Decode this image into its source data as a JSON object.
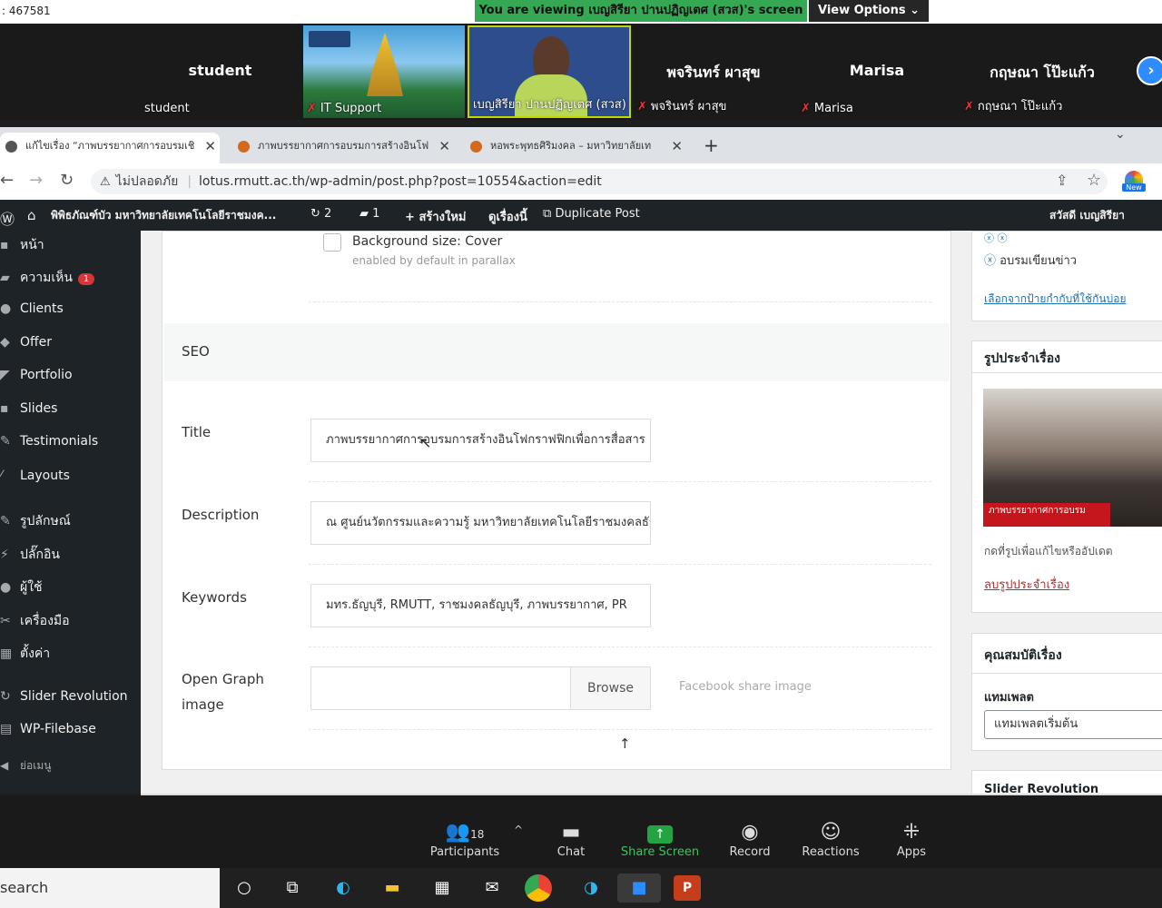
{
  "zoom": {
    "meeting_id": ": 467581",
    "viewing_banner": "You are viewing เบญสิรียา ปานปฏิญเตศ (สวส)'s screen",
    "view_options": "View Options ⌄",
    "participants": [
      {
        "big": "student",
        "small": "student",
        "muted": false
      },
      {
        "big": "",
        "small": "IT Support",
        "muted": true
      },
      {
        "big": "",
        "small": "เบญสิรียา ปานปฏิญเตศ (สวส)",
        "muted": false
      },
      {
        "big": "พจรินทร์ ผาสุข",
        "small": "พจรินทร์ ผาสุข",
        "muted": true
      },
      {
        "big": "Marisa",
        "small": "Marisa",
        "muted": true
      },
      {
        "big": "กฤษณา โป๊ะแก้ว",
        "small": "กฤษณา โป๊ะแก้ว",
        "muted": true
      }
    ],
    "toolbar": {
      "participants_label": "Participants",
      "participants_count": "18",
      "chat": "Chat",
      "share_screen": "Share Screen",
      "record": "Record",
      "reactions": "Reactions",
      "apps": "Apps"
    }
  },
  "browser": {
    "tabs": [
      {
        "title": "แก้ไขเรื่อง “ภาพบรรยากาศการอบรมเชิ"
      },
      {
        "title": "ภาพบรรยากาศการอบรมการสร้างอินโฟ"
      },
      {
        "title": "หอพระพุทธศิริมงคล – มหาวิทยาลัยเท"
      }
    ],
    "security_label": "ไม่ปลอดภัย",
    "url": "lotus.rmutt.ac.th/wp-admin/post.php?post=10554&action=edit",
    "new_badge": "New"
  },
  "wp_adminbar": {
    "site_name": "พิพิธภัณฑ์บัว มหาวิทยาลัยเทคโนโลยีราชมงค...",
    "updates": "2",
    "comments": "1",
    "new_label": "สร้างใหม่",
    "view_post": "ดูเรื่องนี้",
    "duplicate": "Duplicate Post",
    "greeting": "สวัสดี เบญสิรียา"
  },
  "wp_sidebar": {
    "items": [
      {
        "label": "หน้า",
        "icon": "page-icon"
      },
      {
        "label": "ความเห็น",
        "icon": "comment-icon",
        "badge": "1"
      },
      {
        "label": "Clients",
        "icon": "clients-icon"
      },
      {
        "label": "Offer",
        "icon": "offer-icon"
      },
      {
        "label": "Portfolio",
        "icon": "portfolio-icon"
      },
      {
        "label": "Slides",
        "icon": "slides-icon"
      },
      {
        "label": "Testimonials",
        "icon": "testimonials-icon"
      },
      {
        "label": "Layouts",
        "icon": "layouts-icon"
      },
      {
        "label": "รูปลักษณ์",
        "icon": "appearance-icon"
      },
      {
        "label": "ปลั๊กอิน",
        "icon": "plugin-icon"
      },
      {
        "label": "ผู้ใช้",
        "icon": "user-icon"
      },
      {
        "label": "เครื่องมือ",
        "icon": "tools-icon"
      },
      {
        "label": "ตั้งค่า",
        "icon": "settings-icon"
      },
      {
        "label": "Slider Revolution",
        "icon": "slider-icon"
      },
      {
        "label": "WP-Filebase",
        "icon": "filebase-icon"
      },
      {
        "label": "ย่อเมนู",
        "icon": "collapse-icon"
      }
    ]
  },
  "editor": {
    "bg_size_label": "Background size: Cover",
    "bg_size_hint": "enabled by default in parallax",
    "seo_heading": "SEO",
    "title_label": "Title",
    "title_value": "ภาพบรรยากาศการอบรมการสร้างอินโฟกราฟฟิกเพื่อการสื่อสาร",
    "description_label": "Description",
    "description_value": "ณ ศูนย์นวัตกรรมและความรู้ มหาวิทยาลัยเทคโนโลยีราชมงคลธัญบุรี",
    "keywords_label": "Keywords",
    "keywords_value": "มทร.ธัญบุรี, RMUTT, ราชมงคลธัญบุรี, ภาพบรรยากาศ, PR",
    "og_label": "Open Graph image",
    "browse": "Browse",
    "og_hint": "Facebook share image"
  },
  "right_panel": {
    "tag_item": "อบรมเขียนข่าว",
    "choose_tags": "เลือกจากป้ายกำกับที่ใช้กันบ่อย",
    "featured_heading": "รูปประจำเรื่อง",
    "featured_caption": "ภาพบรรยากาศการอบรม",
    "featured_hint": "กดที่รูปเพื่อแก้ไขหรืออัปเดต",
    "remove_featured": "ลบรูปประจำเรื่อง",
    "attributes_heading": "คุณสมบัติเรื่อง",
    "template_label": "แทมเพลต",
    "template_value": "แทมเพลตเริ่มต้น",
    "slider_heading": "Slider Revolution"
  },
  "taskbar": {
    "search": "search"
  }
}
